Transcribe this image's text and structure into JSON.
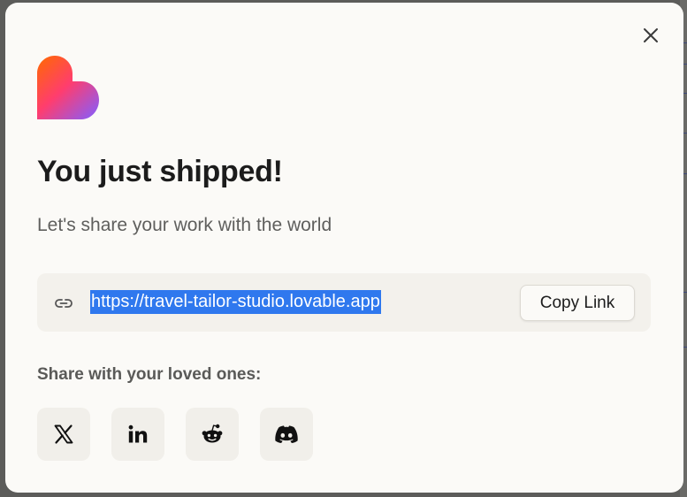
{
  "dialog": {
    "title": "You just shipped!",
    "subtitle": "Let's share your work with the world",
    "close_icon": "close-icon",
    "logo_icon": "heart-logo-icon"
  },
  "link": {
    "icon": "link-icon",
    "url": "https://travel-tailor-studio.lovable.app",
    "url_selected": true,
    "copy_label": "Copy Link"
  },
  "share": {
    "label": "Share with your loved ones:",
    "buttons": [
      {
        "icon": "x-twitter-icon"
      },
      {
        "icon": "linkedin-icon"
      },
      {
        "icon": "reddit-icon"
      },
      {
        "icon": "discord-icon"
      }
    ]
  },
  "colors": {
    "modal_background": "#fbfaf7",
    "link_box_background": "#f3f1ec",
    "selection_highlight": "#2f78ee",
    "text_primary": "#1c1c1c",
    "text_secondary": "#5f5f5d",
    "logo_gradient": [
      "#ff6a00",
      "#ff3d6e",
      "#8b5cf6"
    ]
  }
}
